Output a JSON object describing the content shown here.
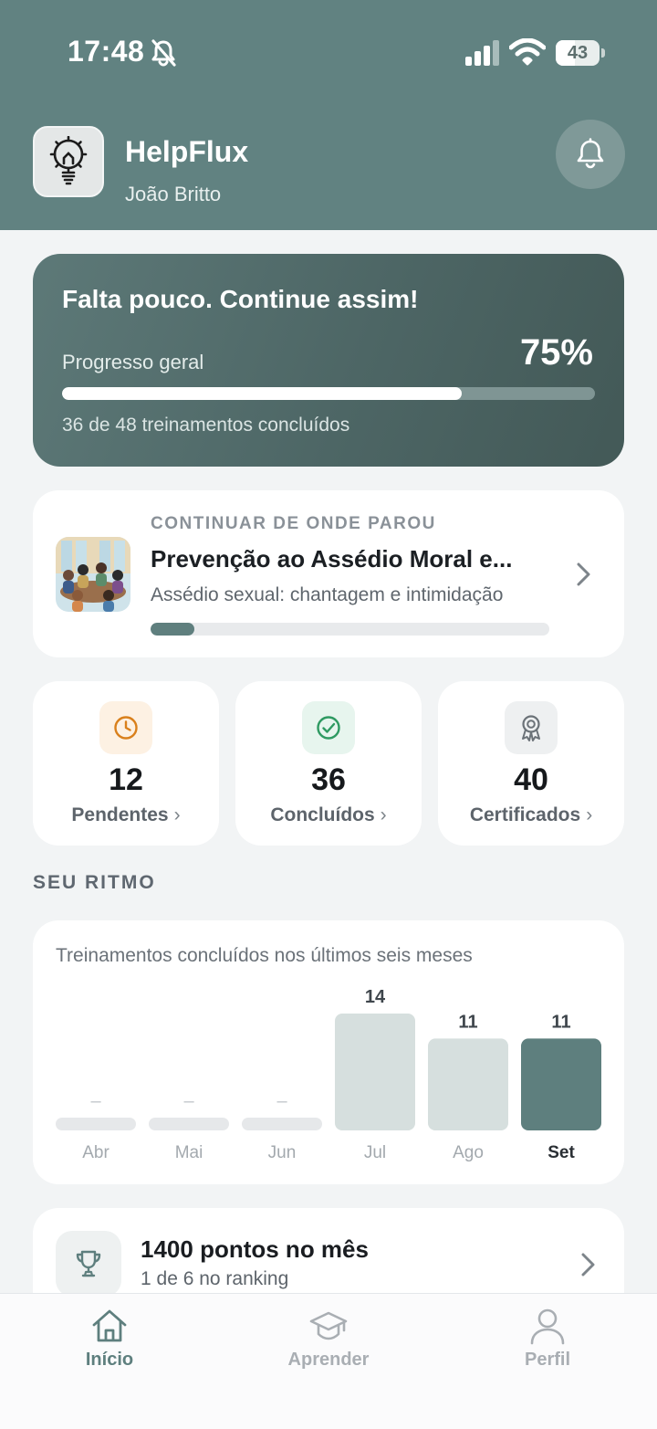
{
  "status_bar": {
    "time": "17:48",
    "battery": "43",
    "battery_level": 0.43
  },
  "header": {
    "app_name": "HelpFlux",
    "user_name": "João Britto"
  },
  "progress": {
    "title": "Falta pouco. Continue assim!",
    "label": "Progresso geral",
    "percent_text": "75%",
    "percent": 75,
    "summary": "36 de 48 treinamentos concluídos"
  },
  "continue": {
    "eyebrow": "CONTINUAR DE ONDE PAROU",
    "title": "Prevenção ao Assédio Moral e...",
    "subtitle": "Assédio sexual: chantagem e intimidação",
    "progress": 11
  },
  "stats": [
    {
      "value": "12",
      "label": "Pendentes",
      "icon": "clock-icon",
      "color": "#d9801c",
      "bg": "#fdf1e3"
    },
    {
      "value": "36",
      "label": "Concluídos",
      "icon": "check-circle-icon",
      "color": "#2f9a62",
      "bg": "#e7f5ee"
    },
    {
      "value": "40",
      "label": "Certificados",
      "icon": "award-icon",
      "color": "#6b7278",
      "bg": "#eef0f1"
    }
  ],
  "section": {
    "title": "SEU RITMO"
  },
  "chart_data": {
    "type": "bar",
    "title": "Treinamentos concluídos nos últimos seis meses",
    "categories": [
      "Abr",
      "Mai",
      "Jun",
      "Jul",
      "Ago",
      "Set"
    ],
    "values": [
      0,
      0,
      0,
      14,
      11,
      11
    ],
    "value_labels": [
      "–",
      "–",
      "–",
      "14",
      "11",
      "11"
    ],
    "highlight_index": 5,
    "ylim": [
      0,
      14
    ],
    "colors": {
      "bar": "#d6dfde",
      "highlight": "#5e7f7e",
      "empty": "#e6e8ea"
    }
  },
  "points": {
    "title": "1400 pontos no mês",
    "subtitle": "1 de 6 no ranking"
  },
  "tabs": [
    {
      "label": "Início",
      "icon": "home-icon",
      "active": true
    },
    {
      "label": "Aprender",
      "icon": "graduation-cap-icon",
      "active": false
    },
    {
      "label": "Perfil",
      "icon": "user-icon",
      "active": false
    }
  ]
}
